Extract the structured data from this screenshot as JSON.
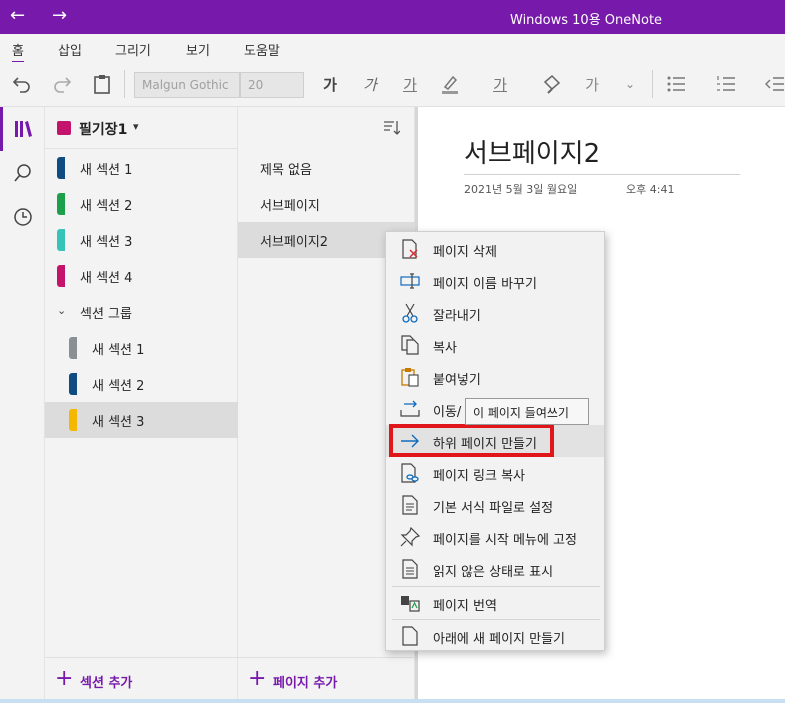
{
  "titlebar": {
    "back_icon": "←",
    "forward_icon": "→",
    "title": "Windows 10용 OneNote",
    "color": "#7719aa"
  },
  "menu": {
    "tabs": [
      "홈",
      "삽입",
      "그리기",
      "보기",
      "도움말"
    ],
    "active": "홈"
  },
  "toolbar": {
    "font_name": "Malgun Gothic",
    "font_size": "20",
    "bold_glyph": "가",
    "italic_glyph": "가",
    "underline_glyph": "가",
    "strike_glyph": "가",
    "clear_glyph": "가"
  },
  "notebook": {
    "name": "필기장1",
    "color": "#c3136c",
    "sections": [
      {
        "label": "새 섹션 1",
        "color": "#0f4c81"
      },
      {
        "label": "새 섹션 2",
        "color": "#1da04c"
      },
      {
        "label": "새 섹션 3",
        "color": "#37c4b8"
      },
      {
        "label": "새 섹션 4",
        "color": "#c3136c"
      }
    ],
    "group": {
      "label": "섹션 그룹",
      "sections": [
        {
          "label": "새 섹션 1",
          "color": "#8a8f94"
        },
        {
          "label": "새 섹션 2",
          "color": "#0f4c81"
        },
        {
          "label": "새 섹션 3",
          "color": "#f5b800"
        }
      ]
    },
    "add_section": "섹션 추가"
  },
  "pages": {
    "items": [
      "제목 없음",
      "서브페이지",
      "서브페이지2"
    ],
    "selected": "서브페이지2",
    "add_page": "페이지 추가"
  },
  "canvas": {
    "title": "서브페이지2",
    "date": "2021년 5월 3일 월요일",
    "time": "오후 4:41"
  },
  "context_menu": {
    "items": [
      {
        "label": "페이지 삭제",
        "icon": "delete-page-icon"
      },
      {
        "label": "페이지 이름 바꾸기",
        "icon": "rename-icon"
      },
      {
        "label": "잘라내기",
        "icon": "scissors-icon"
      },
      {
        "label": "복사",
        "icon": "copy-icon"
      },
      {
        "label": "붙여넣기",
        "icon": "paste-icon"
      },
      {
        "label": "이동/복사",
        "icon": "move-icon"
      },
      {
        "label": "하위 페이지 만들기",
        "icon": "arrow-right-icon"
      },
      {
        "label": "페이지 링크 복사",
        "icon": "link-icon"
      },
      {
        "label": "기본 서식 파일로 설정",
        "icon": "template-icon"
      },
      {
        "label": "페이지를 시작 메뉴에 고정",
        "icon": "pin-icon"
      },
      {
        "label": "읽지 않은 상태로 표시",
        "icon": "unread-icon"
      },
      {
        "label": "페이지 번역",
        "icon": "translate-icon"
      },
      {
        "label": "아래에 새 페이지 만들기",
        "icon": "new-page-icon"
      }
    ],
    "visible_move_label": "이동/",
    "highlighted": "하위 페이지 만들기",
    "highlight_color": "#e0161a"
  },
  "tooltip": {
    "text": "이 페이지 들여쓰기"
  }
}
